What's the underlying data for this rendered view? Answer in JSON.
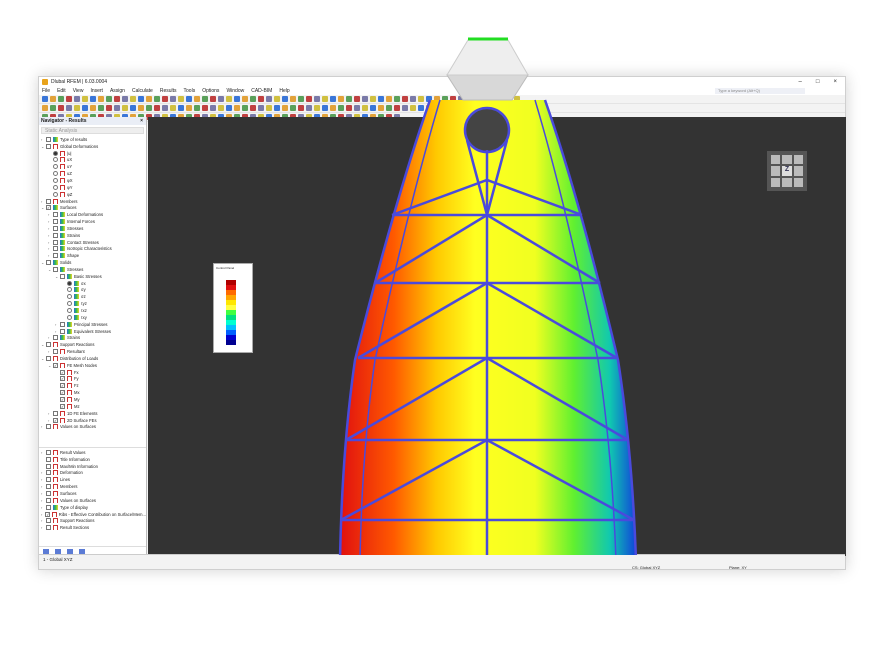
{
  "app": {
    "title": "Dlubal RFEM | 6.03.0004",
    "window_controls": [
      "–",
      "□",
      "×"
    ]
  },
  "menu": [
    "File",
    "Edit",
    "View",
    "Insert",
    "Assign",
    "Calculate",
    "Results",
    "Tools",
    "Options",
    "Window",
    "CAD-BIM",
    "Help"
  ],
  "search": {
    "placeholder": "Type a keyword (Alt+Q)"
  },
  "navigator": {
    "title": "Navigator - Results",
    "combo": "Static Analysis",
    "tree": [
      {
        "d": 0,
        "a": "›",
        "c": "box",
        "i": "",
        "l": "Type of results"
      },
      {
        "d": 0,
        "a": "⌄",
        "c": "box",
        "i": "red",
        "l": "Global Deformations"
      },
      {
        "d": 1,
        "a": "",
        "c": "radio-on",
        "i": "red",
        "l": "|u|"
      },
      {
        "d": 1,
        "a": "",
        "c": "radio",
        "i": "red",
        "l": "uX"
      },
      {
        "d": 1,
        "a": "",
        "c": "radio",
        "i": "red",
        "l": "uY"
      },
      {
        "d": 1,
        "a": "",
        "c": "radio",
        "i": "red",
        "l": "uZ"
      },
      {
        "d": 1,
        "a": "",
        "c": "radio",
        "i": "red",
        "l": "φX"
      },
      {
        "d": 1,
        "a": "",
        "c": "radio",
        "i": "red",
        "l": "φY"
      },
      {
        "d": 1,
        "a": "",
        "c": "radio",
        "i": "red",
        "l": "φZ"
      },
      {
        "d": 0,
        "a": "›",
        "c": "box",
        "i": "red",
        "l": "Members"
      },
      {
        "d": 0,
        "a": "⌄",
        "c": "check",
        "i": "col",
        "l": "Surfaces"
      },
      {
        "d": 1,
        "a": "›",
        "c": "box",
        "i": "col",
        "l": "Local Deformations"
      },
      {
        "d": 1,
        "a": "›",
        "c": "box",
        "i": "col",
        "l": "Internal Forces"
      },
      {
        "d": 1,
        "a": "›",
        "c": "box",
        "i": "col",
        "l": "Stresses"
      },
      {
        "d": 1,
        "a": "›",
        "c": "box",
        "i": "col",
        "l": "Strains"
      },
      {
        "d": 1,
        "a": "›",
        "c": "box",
        "i": "col",
        "l": "Contact Stresses"
      },
      {
        "d": 1,
        "a": "›",
        "c": "box",
        "i": "col",
        "l": "Isotropic Characteristics"
      },
      {
        "d": 1,
        "a": "›",
        "c": "box",
        "i": "col",
        "l": "Shape"
      },
      {
        "d": 0,
        "a": "⌄",
        "c": "box",
        "i": "col",
        "l": "Solids"
      },
      {
        "d": 1,
        "a": "⌄",
        "c": "box",
        "i": "col",
        "l": "Stresses"
      },
      {
        "d": 2,
        "a": "⌄",
        "c": "box",
        "i": "col",
        "l": "Basic Stresses"
      },
      {
        "d": 3,
        "a": "",
        "c": "radio-on",
        "i": "col",
        "l": "σx"
      },
      {
        "d": 3,
        "a": "",
        "c": "radio",
        "i": "col",
        "l": "σy"
      },
      {
        "d": 3,
        "a": "",
        "c": "radio",
        "i": "col",
        "l": "σz"
      },
      {
        "d": 3,
        "a": "",
        "c": "radio",
        "i": "col",
        "l": "τyz"
      },
      {
        "d": 3,
        "a": "",
        "c": "radio",
        "i": "col",
        "l": "τxz"
      },
      {
        "d": 3,
        "a": "",
        "c": "radio",
        "i": "col",
        "l": "τxy"
      },
      {
        "d": 2,
        "a": "›",
        "c": "box",
        "i": "col",
        "l": "Principal Stresses"
      },
      {
        "d": 2,
        "a": "›",
        "c": "box",
        "i": "col",
        "l": "Equivalent Stresses"
      },
      {
        "d": 1,
        "a": "›",
        "c": "box",
        "i": "col",
        "l": "Strains"
      },
      {
        "d": 0,
        "a": "⌄",
        "c": "box",
        "i": "red",
        "l": "Support Reactions"
      },
      {
        "d": 1,
        "a": "›",
        "c": "box",
        "i": "red",
        "l": "Resultant"
      },
      {
        "d": 0,
        "a": "⌄",
        "c": "box",
        "i": "red",
        "l": "Distribution of Loads"
      },
      {
        "d": 1,
        "a": "⌄",
        "c": "check",
        "i": "red",
        "l": "FE Mesh Nodes"
      },
      {
        "d": 2,
        "a": "",
        "c": "check",
        "i": "red",
        "l": "Fx"
      },
      {
        "d": 2,
        "a": "",
        "c": "check",
        "i": "red",
        "l": "Fy"
      },
      {
        "d": 2,
        "a": "",
        "c": "check",
        "i": "red",
        "l": "Fz"
      },
      {
        "d": 2,
        "a": "",
        "c": "check",
        "i": "red",
        "l": "Mx"
      },
      {
        "d": 2,
        "a": "",
        "c": "check",
        "i": "red",
        "l": "My"
      },
      {
        "d": 2,
        "a": "",
        "c": "check",
        "i": "red",
        "l": "Mz"
      },
      {
        "d": 1,
        "a": "›",
        "c": "box",
        "i": "red",
        "l": "1D FE Elements"
      },
      {
        "d": 1,
        "a": "›",
        "c": "check",
        "i": "red",
        "l": "2D Surface FEs"
      },
      {
        "d": 0,
        "a": "›",
        "c": "box",
        "i": "red",
        "l": "Values on Surfaces"
      }
    ],
    "tree2": [
      {
        "d": 0,
        "a": "›",
        "c": "box",
        "i": "red",
        "l": "Result Values"
      },
      {
        "d": 0,
        "a": "",
        "c": "box",
        "i": "red",
        "l": "Title Information"
      },
      {
        "d": 0,
        "a": "",
        "c": "box",
        "i": "red",
        "l": "Max/Min Information"
      },
      {
        "d": 0,
        "a": "›",
        "c": "box",
        "i": "red",
        "l": "Deformation"
      },
      {
        "d": 0,
        "a": "›",
        "c": "box",
        "i": "red",
        "l": "Lines"
      },
      {
        "d": 0,
        "a": "›",
        "c": "box",
        "i": "red",
        "l": "Members"
      },
      {
        "d": 0,
        "a": "›",
        "c": "box",
        "i": "red",
        "l": "Surfaces"
      },
      {
        "d": 0,
        "a": "›",
        "c": "box",
        "i": "red",
        "l": "Values on Surfaces"
      },
      {
        "d": 0,
        "a": "›",
        "c": "box",
        "i": "col",
        "l": "Type of display"
      },
      {
        "d": 0,
        "a": "›",
        "c": "check",
        "i": "red",
        "l": "Ribs - Effective Contribution on Surface/Mem..."
      },
      {
        "d": 0,
        "a": "›",
        "c": "box",
        "i": "red",
        "l": "Support Reactions"
      },
      {
        "d": 0,
        "a": "›",
        "c": "box",
        "i": "red",
        "l": "Result Sections"
      }
    ]
  },
  "status": {
    "coord_system": "1 - Global XYZ",
    "cs": "CS: Global XYZ",
    "plane": "Plane: XY"
  },
  "legend": {
    "title": "Control Panel",
    "colors": [
      "#b00000",
      "#e01010",
      "#ff6a00",
      "#ffa500",
      "#ffe600",
      "#ffff40",
      "#40ff40",
      "#00e080",
      "#00ffd0",
      "#00c0ff",
      "#0060ff",
      "#0000d0",
      "#000090"
    ]
  },
  "colors": {
    "viewport": "#333333",
    "frame": "#4a4adc",
    "accent": "#2a6fdc"
  }
}
